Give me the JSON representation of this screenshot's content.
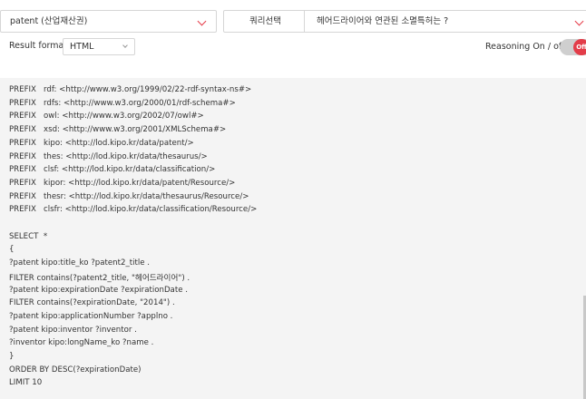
{
  "dataset_select": {
    "value": "patent (산업재산권)"
  },
  "query_select": {
    "label": "쿼리선택",
    "value": "헤어드라이어와 연관된 소멸특허는 ?"
  },
  "result_format": {
    "label": "Result format",
    "value": "HTML"
  },
  "reasoning": {
    "label": "Reasoning On / off",
    "state": "Off"
  },
  "query": {
    "prefixes": [
      {
        "kw": "PREFIX",
        "rest": "rdf: <http://www.w3.org/1999/02/22-rdf-syntax-ns#>"
      },
      {
        "kw": "PREFIX",
        "rest": "rdfs: <http://www.w3.org/2000/01/rdf-schema#>"
      },
      {
        "kw": "PREFIX",
        "rest": "owl: <http://www.w3.org/2002/07/owl#>"
      },
      {
        "kw": "PREFIX",
        "rest": "xsd: <http://www.w3.org/2001/XMLSchema#>"
      },
      {
        "kw": "PREFIX",
        "rest": "kipo: <http://lod.kipo.kr/data/patent/>"
      },
      {
        "kw": "PREFIX",
        "rest": "thes: <http://lod.kipo.kr/data/thesaurus/>"
      },
      {
        "kw": "PREFIX",
        "rest": "clsf: <http://lod.kipo.kr/data/classification/>"
      },
      {
        "kw": "PREFIX",
        "rest": "kipor: <http://lod.kipo.kr/data/patent/Resource/>"
      },
      {
        "kw": "PREFIX",
        "rest": "thesr: <http://lod.kipo.kr/data/thesaurus/Resource/>"
      },
      {
        "kw": "PREFIX",
        "rest": "clsfr: <http://lod.kipo.kr/data/classification/Resource/>"
      }
    ],
    "body": [
      "SELECT  *",
      "{",
      "?patent kipo:title_ko ?patent2_title .",
      "FILTER contains(?patent2_title, \"헤어드라이어\") .",
      "?patent kipo:expirationDate ?expirationDate .",
      "FILTER contains(?expirationDate, \"2014\") .",
      "?patent kipo:applicationNumber ?applno .",
      "?patent kipo:inventor ?inventor .",
      "?inventor kipo:longName_ko ?name .",
      "}",
      "ORDER BY DESC(?expirationDate)",
      "LIMIT 10"
    ]
  }
}
